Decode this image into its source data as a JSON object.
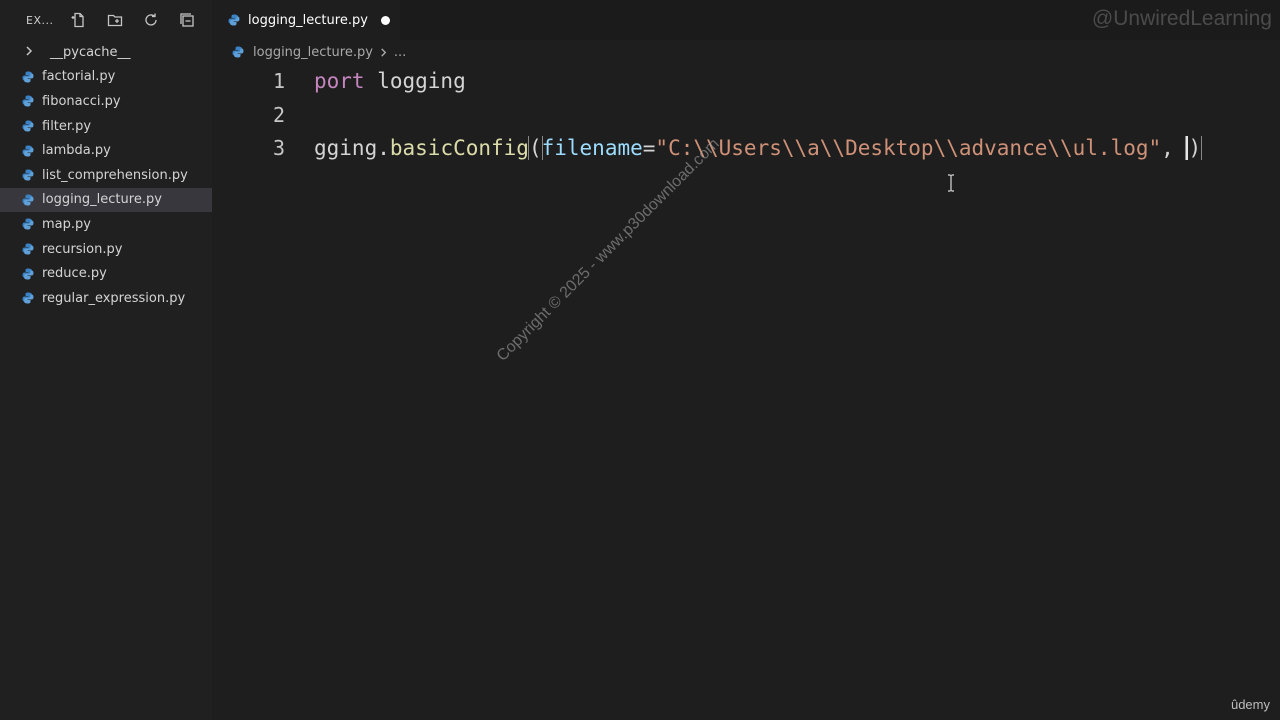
{
  "sidebar": {
    "title": "EX...",
    "toolbar": [
      "new-file-icon",
      "new-folder-icon",
      "refresh-icon",
      "collapse-all-icon"
    ],
    "folder": "__pycache__",
    "files": [
      "factorial.py",
      "fibonacci.py",
      "filter.py",
      "lambda.py",
      "list_comprehension.py",
      "logging_lecture.py",
      "map.py",
      "recursion.py",
      "reduce.py",
      "regular_expression.py"
    ],
    "active_index": 5
  },
  "tab": {
    "label": "logging_lecture.py",
    "dirty": true
  },
  "brand_watermark": "@UnwiredLearning",
  "breadcrumb": {
    "file": "logging_lecture.py",
    "rest": "..."
  },
  "editor": {
    "lines": [
      {
        "num": "1",
        "kw": "port",
        "rest": " logging"
      },
      {
        "num": "2"
      },
      {
        "num": "3",
        "obj": "gging",
        "dot": ".",
        "fn": "basicConfig",
        "open": "(",
        "param": "filename",
        "eq": "=",
        "str": "\"C:\\\\Users\\\\a\\\\Desktop\\\\advance\\\\ul.log\"",
        "comma": ", ",
        "close": ")"
      }
    ]
  },
  "copyright": "Copyright © 2025 - www.p30download.com",
  "udemy": "ûdemy",
  "colors": {
    "keyword": "#c586c0",
    "function": "#dcdcaa",
    "param": "#9cdcfe",
    "string": "#ce9178",
    "python": "#3b82c4"
  }
}
